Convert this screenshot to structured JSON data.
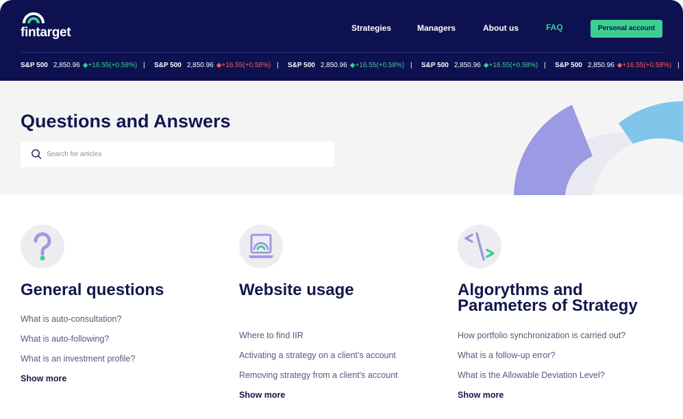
{
  "brand": {
    "name": "fintarget"
  },
  "nav": {
    "items": [
      {
        "label": "Strategies",
        "active": false
      },
      {
        "label": "Managers",
        "active": false
      },
      {
        "label": "About us",
        "active": false
      },
      {
        "label": "FAQ",
        "active": true
      }
    ],
    "cta_label": "Personal account"
  },
  "ticker": [
    {
      "symbol": "S&P 500",
      "price": "2,850.96",
      "change": "+16.55(+0.58%)",
      "direction": "up"
    },
    {
      "symbol": "S&P 500",
      "price": "2,850.96",
      "change": "+16.55(+0.58%)",
      "direction": "down"
    },
    {
      "symbol": "S&P 500",
      "price": "2,850.96",
      "change": "+16.55(+0.58%)",
      "direction": "up"
    },
    {
      "symbol": "S&P 500",
      "price": "2,850.96",
      "change": "+16.55(+0.58%)",
      "direction": "up"
    },
    {
      "symbol": "S&P 500",
      "price": "2,850.96",
      "change": "+16.55(+0.58%)",
      "direction": "down"
    }
  ],
  "hero": {
    "title": "Questions and Answers",
    "search_placeholder": "Search for articles"
  },
  "categories": [
    {
      "icon": "question-icon",
      "title": "General questions",
      "links": [
        "What is auto-consultation?",
        "What is auto-following?",
        "What is an investment profile?"
      ],
      "show_more": "Show more"
    },
    {
      "icon": "laptop-icon",
      "title": "Website usage",
      "links": [
        "Where to find IIR",
        "Activating a strategy on a client's account",
        "Removing strategy from a client's account"
      ],
      "show_more": "Show more"
    },
    {
      "icon": "code-icon",
      "title": "Algorythms and Parameters of Strategy",
      "links": [
        "How portfolio synchronization is carried out?",
        "What is a follow-up error?",
        "What is the Allowable Deviation Level?"
      ],
      "show_more": "Show more"
    }
  ],
  "colors": {
    "navy": "#0d1150",
    "accent_green": "#3ccf91",
    "down_red": "#ff5b5b",
    "purple": "#9b9be3",
    "sky": "#7fc6ea"
  }
}
